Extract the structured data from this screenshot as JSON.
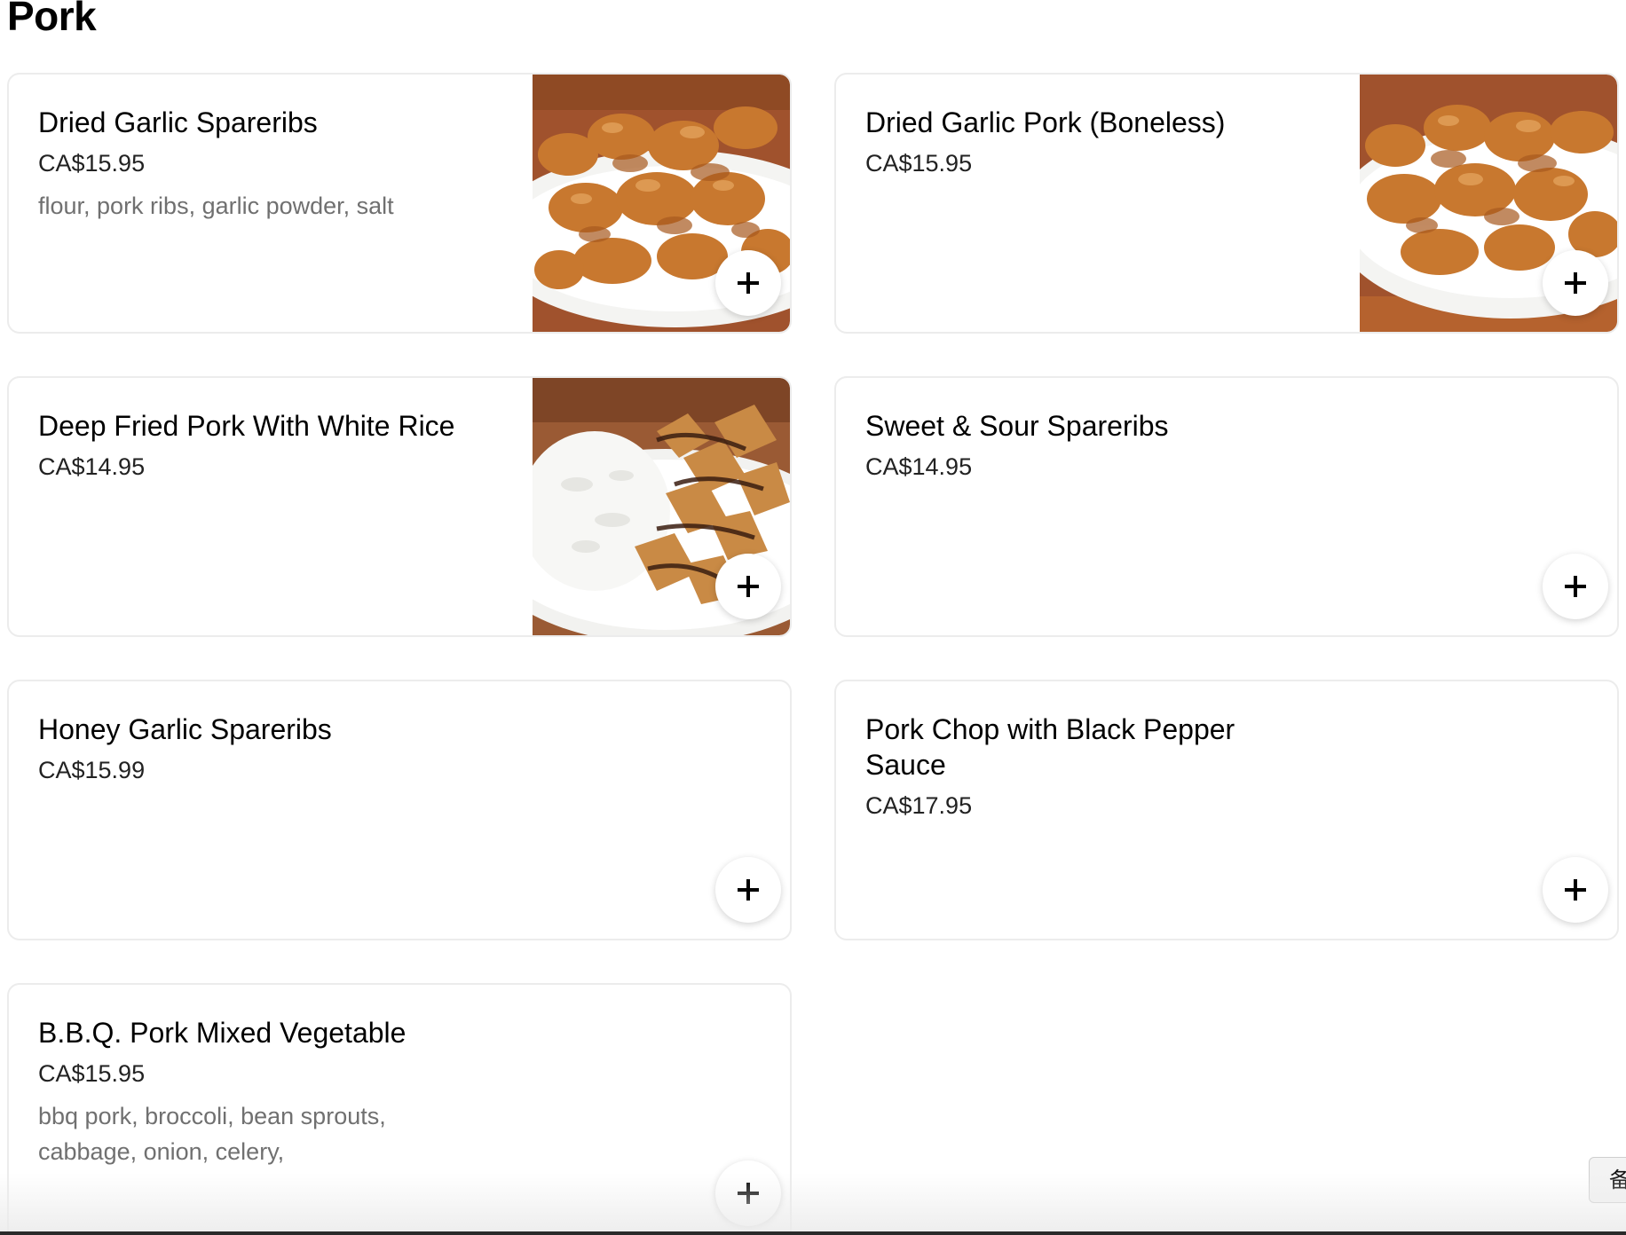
{
  "section": {
    "title": "Pork"
  },
  "items": [
    {
      "name": "Dried Garlic Spareribs",
      "price": "CA$15.95",
      "description": "flour, pork ribs, garlic powder, salt",
      "has_image": true,
      "image_subject": "fried-pork-pieces-on-plate"
    },
    {
      "name": "Dried Garlic Pork (Boneless)",
      "price": "CA$15.95",
      "description": "",
      "has_image": true,
      "image_subject": "fried-pork-pieces-on-plate"
    },
    {
      "name": "Deep Fried Pork With White Rice",
      "price": "CA$14.95",
      "description": "",
      "has_image": true,
      "image_subject": "breaded-pork-cutlet-with-rice"
    },
    {
      "name": "Sweet & Sour Spareribs",
      "price": "CA$14.95",
      "description": "",
      "has_image": false
    },
    {
      "name": "Honey Garlic Spareribs",
      "price": "CA$15.99",
      "description": "",
      "has_image": false
    },
    {
      "name": "Pork Chop with Black Pepper Sauce",
      "price": "CA$17.95",
      "description": "",
      "has_image": false
    },
    {
      "name": "B.B.Q. Pork Mixed Vegetable",
      "price": "CA$15.95",
      "description": "bbq pork, broccoli, bean sprouts, cabbage, onion, celery,",
      "has_image": false
    }
  ],
  "add_button": {
    "icon": "plus-icon"
  },
  "side_tab": {
    "label": "备"
  },
  "colors": {
    "card_border": "#ececec",
    "description_text": "#707070",
    "plate_wood": "#a0522d",
    "fried_pork": "#c8782f"
  }
}
